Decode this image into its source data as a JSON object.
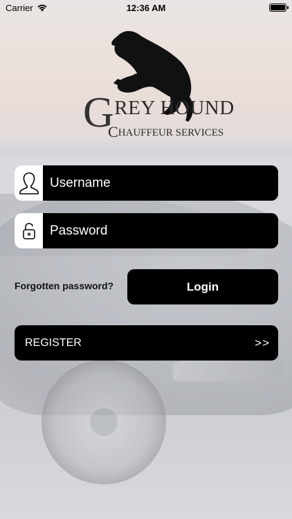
{
  "status_bar": {
    "carrier": "Carrier",
    "time": "12:36 AM",
    "icons": [
      "wifi-icon",
      "battery-icon"
    ]
  },
  "logo": {
    "letter_g": "G",
    "line1_rest": "REY HOUND",
    "letter_c": "C",
    "line2_rest": "HAUFFEUR SERVICES",
    "icon": "greyhound-dog-icon"
  },
  "login_form": {
    "username_placeholder": "Username",
    "password_placeholder": "Password",
    "username_icon": "user-icon",
    "password_icon": "lock-icon",
    "forgot_password_label": "Forgotten password?",
    "login_label": "Login",
    "register_label": "REGISTER",
    "register_arrow": ">>"
  },
  "colors": {
    "button_bg": "#000000",
    "button_text": "#ffffff"
  }
}
